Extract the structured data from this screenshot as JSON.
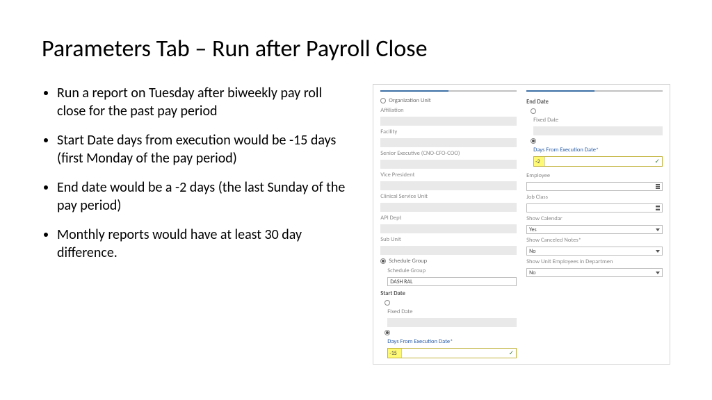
{
  "title": "Parameters Tab – Run after Payroll Close",
  "bullets": [
    "Run a report on Tuesday after biweekly pay roll close for the past pay period",
    "Start Date days from execution would be -15 days (first Monday of the pay period)",
    "End date would be a -2 days (the last Sunday of the pay period)",
    "Monthly reports would have at least 30 day difference."
  ],
  "form": {
    "left": {
      "orgUnit": "Organization Unit",
      "affiliation": "Affiliation",
      "facility": "Facility",
      "seniorExec": "Senior Executive (CNO-CFO-COO)",
      "vicePresident": "Vice President",
      "clinicalService": "Clinical Service Unit",
      "apiDept": "API Dept",
      "subUnit": "Sub Unit",
      "scheduleGroup": "Schedule Group",
      "scheduleGroupLabel": "Schedule Group",
      "scheduleGroupValue": "DASH RAL",
      "startDate": "Start Date",
      "fixedDate": "Fixed Date",
      "daysFromExec": "Days From Execution Date*",
      "daysFromExecValue": "-15"
    },
    "right": {
      "endDate": "End Date",
      "fixedDate": "Fixed Date",
      "daysFromExec": "Days From Execution Date*",
      "daysFromExecValue": "-2",
      "employee": "Employee",
      "jobClass": "Job Class",
      "showCalendar": "Show Calendar",
      "showCalendarValue": "Yes",
      "showCanceled": "Show Canceled Notes*",
      "showCanceledValue": "No",
      "showUnitEmp": "Show Unit Employees in Departmen",
      "showUnitEmpValue": "No"
    }
  }
}
